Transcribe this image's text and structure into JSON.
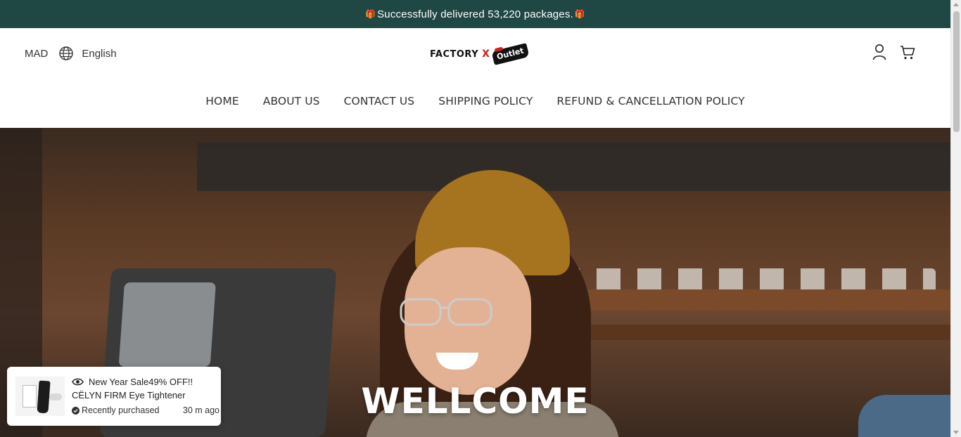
{
  "announcement": {
    "text": "Successfully delivered 53,220 packages.",
    "left_icon": "gift-icon",
    "right_icon": "gift-icon"
  },
  "header": {
    "currency": "MAD",
    "language": "English",
    "logo": {
      "word": "FACTORY",
      "x": "X",
      "badge": "Outlet"
    },
    "icons": {
      "account": "account-icon",
      "cart": "cart-icon"
    }
  },
  "nav": {
    "items": [
      "HOME",
      "ABOUT US",
      "CONTACT US",
      "SHIPPING POLICY",
      "REFUND & CANCELLATION POLICY"
    ]
  },
  "hero": {
    "title": "WELLCOME"
  },
  "popup": {
    "promo": "New Year Sale49% OFF!!",
    "product": "CËLYN FIRM Eye Tightener",
    "status": "Recently purchased",
    "time": "30 m ago"
  },
  "colors": {
    "announcement_bg": "#1f4744",
    "logo_accent": "#d41e1e"
  }
}
